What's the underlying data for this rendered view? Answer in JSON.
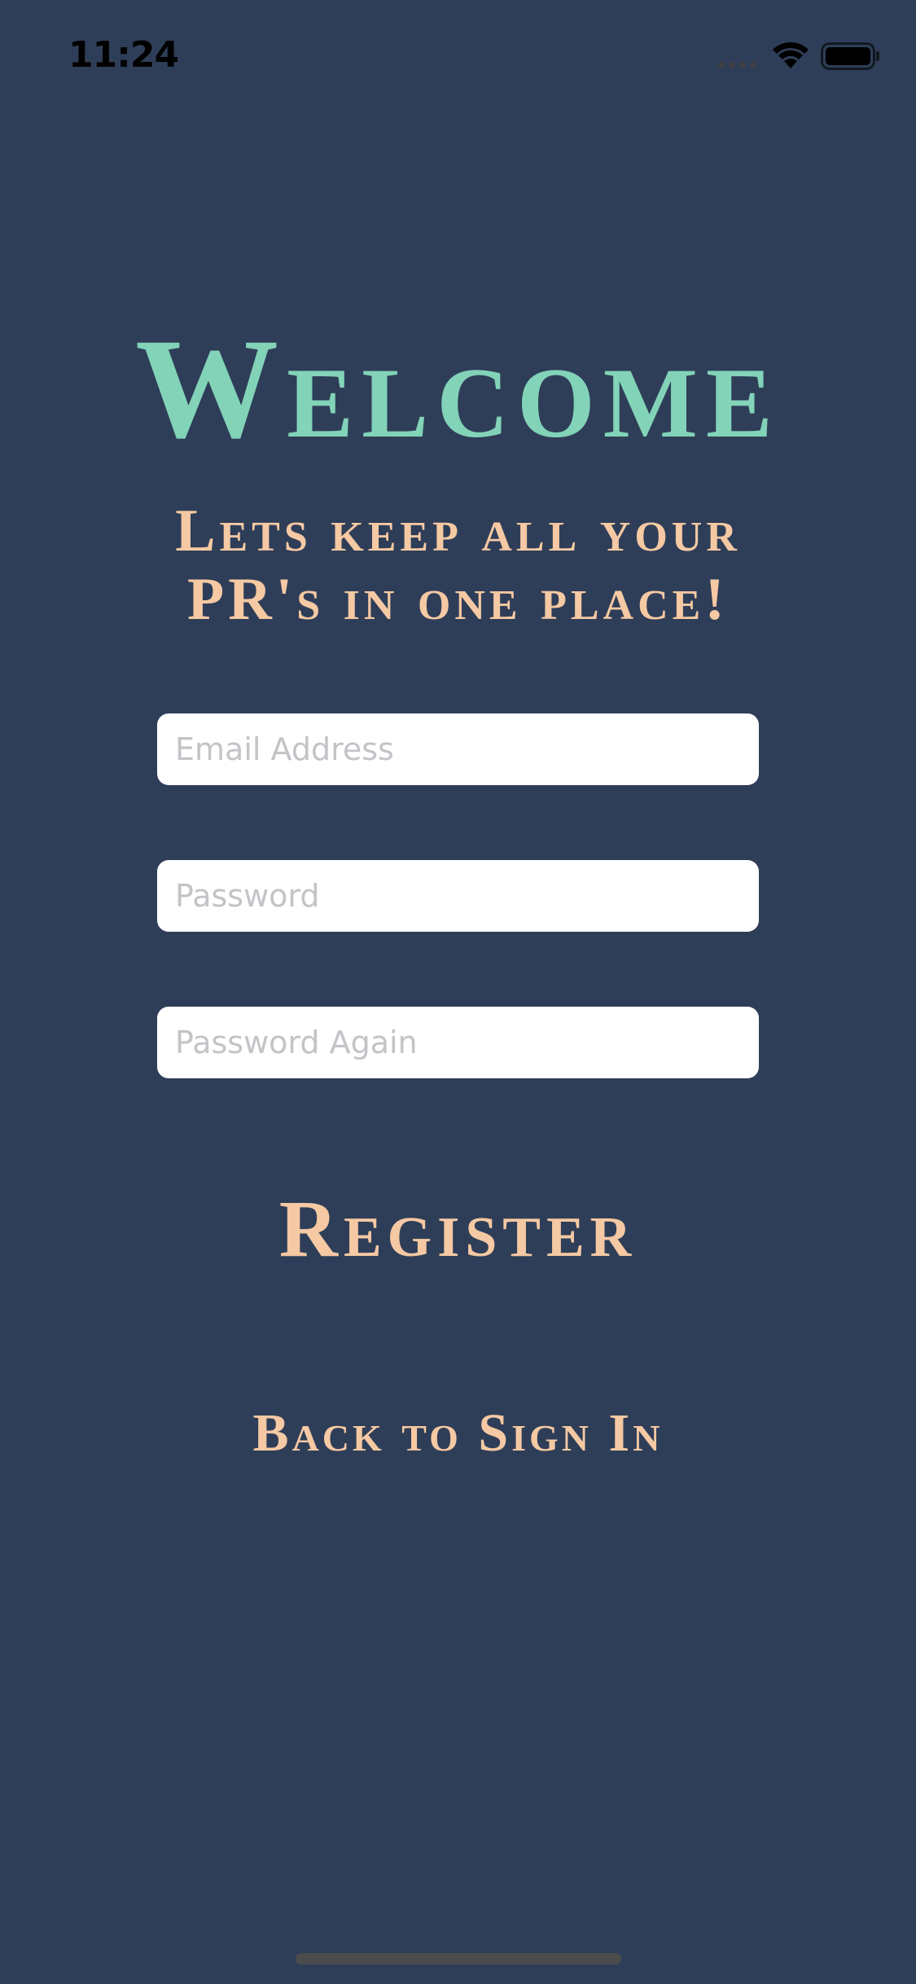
{
  "status_bar": {
    "time": "11:24",
    "icons": [
      "cellular-signal-icon",
      "wifi-icon",
      "battery-icon"
    ],
    "icon_color": "#000000"
  },
  "welcome": {
    "title": "Welcome",
    "subtitle_line1": "Lets keep all your",
    "subtitle_line2": "PR's in one place!"
  },
  "form": {
    "email": {
      "value": "",
      "placeholder": "Email Address"
    },
    "password": {
      "value": "",
      "placeholder": "Password"
    },
    "password_again": {
      "value": "",
      "placeholder": "Password Again"
    }
  },
  "actions": {
    "register_label": "Register",
    "back_label": "Back to Sign In"
  },
  "colors": {
    "background": "#2f3e58",
    "title": "#82d3b8",
    "accent": "#f5c9a3",
    "field_background": "#ffffff",
    "placeholder": "#c3c3c8"
  }
}
